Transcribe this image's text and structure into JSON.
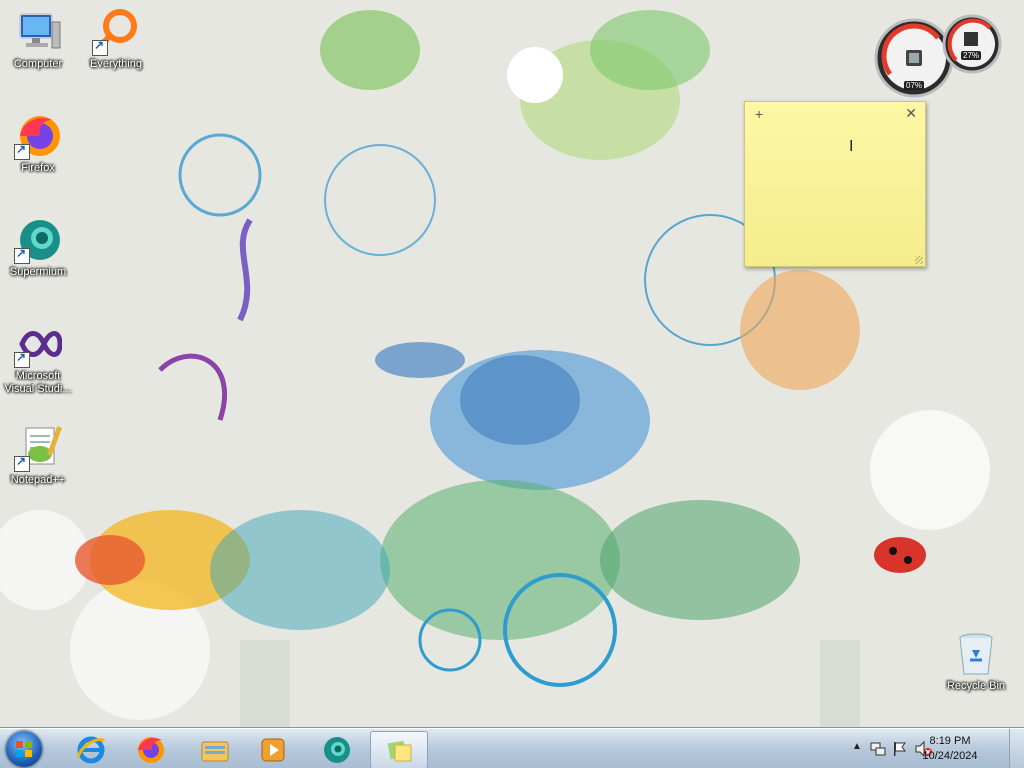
{
  "desktop": {
    "icons": [
      {
        "label": "Computer",
        "icon": "computer-icon"
      },
      {
        "label": "Everything",
        "icon": "everything-icon"
      },
      {
        "label": "Firefox",
        "icon": "firefox-icon"
      },
      {
        "label": "Supermium",
        "icon": "supermium-icon"
      },
      {
        "label": "Microsoft Visual Studi...",
        "icon": "visual-studio-icon"
      },
      {
        "label": "Notepad++",
        "icon": "notepadpp-icon"
      },
      {
        "label": "Recycle Bin",
        "icon": "recycle-bin-icon"
      }
    ]
  },
  "gadget": {
    "cpu_percent": "07%",
    "memory_percent": "27%"
  },
  "sticky_note": {
    "add_label": "+",
    "close_label": "✕"
  },
  "taskbar": {
    "items": [
      {
        "name": "internet-explorer",
        "icon": "ie-icon"
      },
      {
        "name": "firefox",
        "icon": "firefox-icon"
      },
      {
        "name": "file-explorer",
        "icon": "folder-icon"
      },
      {
        "name": "media-player",
        "icon": "media-player-icon"
      },
      {
        "name": "supermium",
        "icon": "supermium-icon"
      },
      {
        "name": "sticky-notes",
        "icon": "sticky-notes-icon"
      }
    ],
    "clock": {
      "time": "8:19 PM",
      "date": "10/24/2024"
    },
    "tray_icons": [
      "show-hidden-icon",
      "network-icon",
      "action-center-flag-icon",
      "volume-muted-icon"
    ]
  },
  "colors": {
    "taskbar": "#b6c8da",
    "sticky": "#fdf7a6"
  }
}
